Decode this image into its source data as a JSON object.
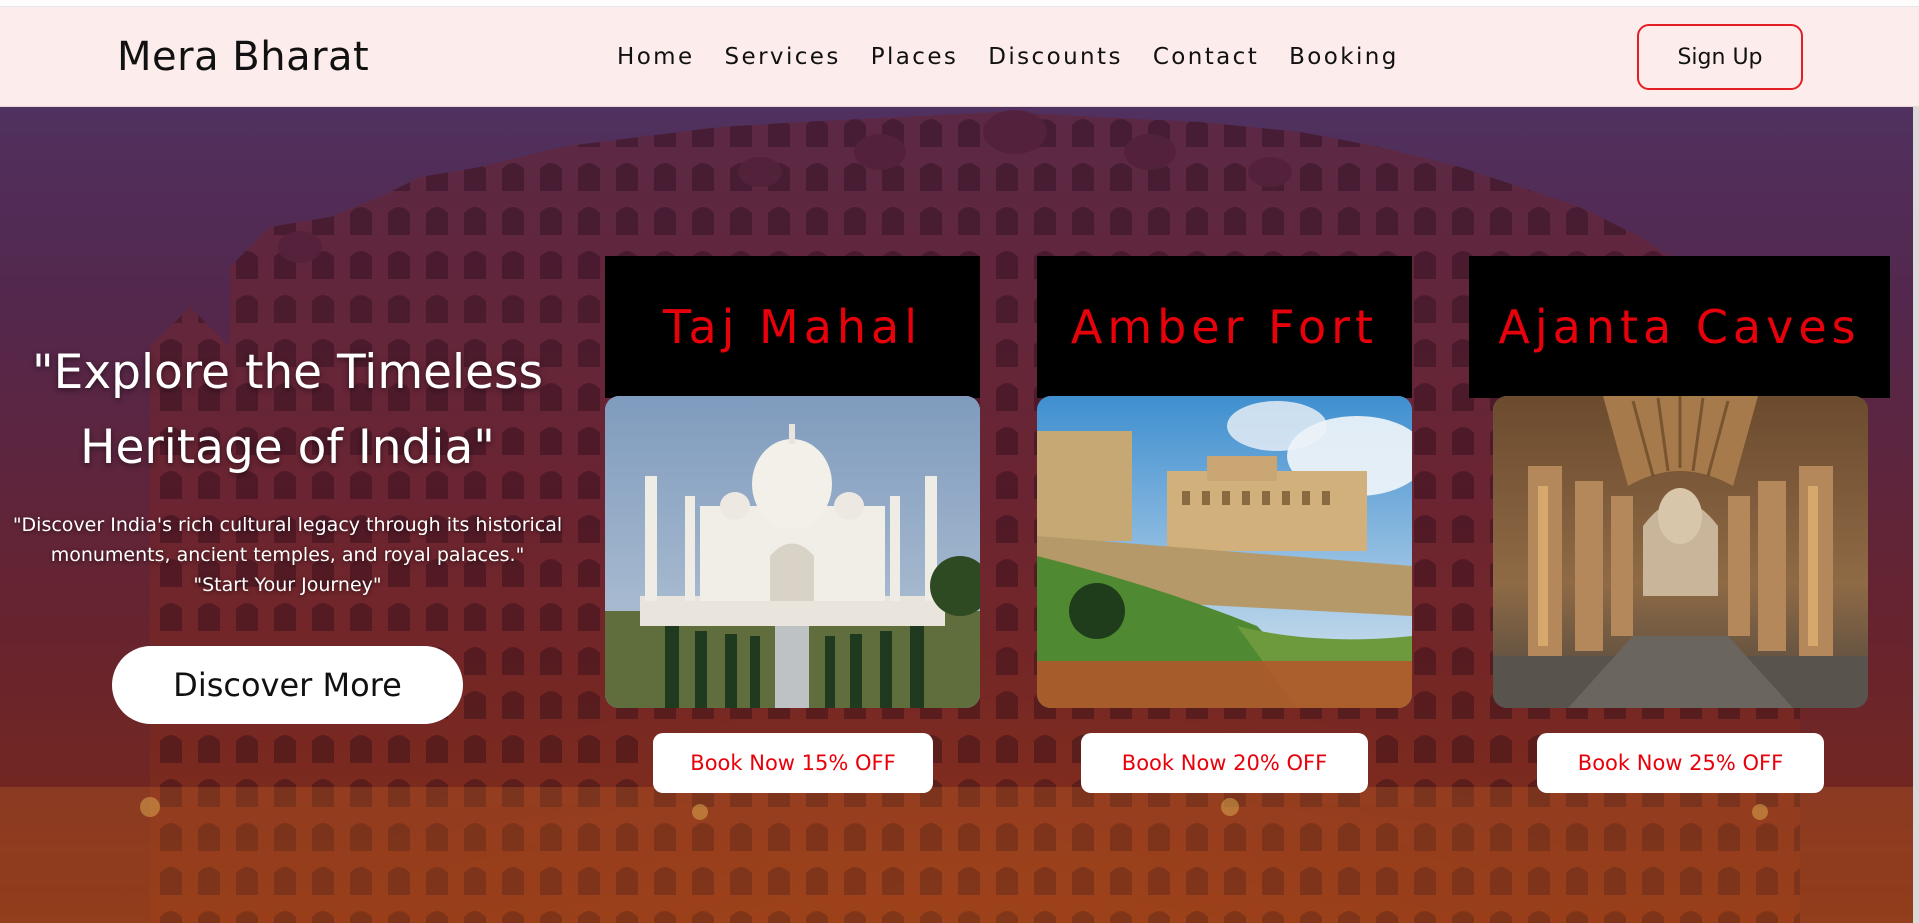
{
  "brand": "Mera Bharat",
  "nav": {
    "items": [
      "Home",
      "Services",
      "Places",
      "Discounts",
      "Contact",
      "Booking"
    ],
    "signup_label": "Sign Up"
  },
  "hero": {
    "title_line1": "\"Explore the Timeless",
    "title_line2": "Heritage of India\"",
    "sub_line1": "\"Discover India's rich cultural legacy through its historical",
    "sub_line2": "monuments, ancient temples, and royal palaces.\"",
    "sub_line3": "\"Start Your Journey\"",
    "cta_label": "Discover More"
  },
  "cards": [
    {
      "title": "Taj Mahal",
      "button": "Book Now 15% OFF",
      "image": "taj-mahal-photo"
    },
    {
      "title": "Amber Fort",
      "button": "Book Now 20% OFF",
      "image": "amber-fort-photo"
    },
    {
      "title": "Ajanta Caves",
      "button": "Book Now 25% OFF",
      "image": "ajanta-caves-photo"
    }
  ],
  "colors": {
    "navbar_bg": "#fdecec",
    "accent_red": "#e8000b",
    "signup_border": "#e31e24",
    "card_head_bg": "#000000"
  }
}
